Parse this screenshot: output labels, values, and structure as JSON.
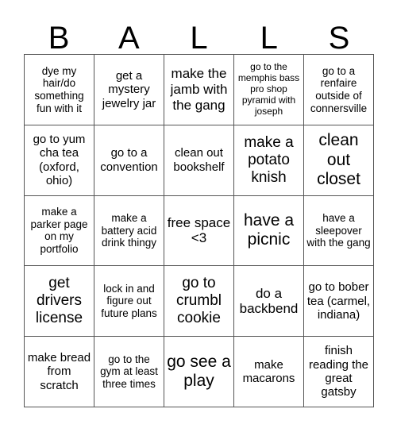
{
  "card": {
    "header_letters": [
      "B",
      "A",
      "L",
      "L",
      "S"
    ],
    "colors": {
      "background": "#ffffff",
      "text": "#000000",
      "grid_line": "#555555"
    },
    "grid_size": "5x5",
    "rows": [
      [
        {
          "text": "dye my hair/do something fun with it",
          "size": "s"
        },
        {
          "text": "get a mystery jewelry jar",
          "size": "m"
        },
        {
          "text": "make the jamb with the gang",
          "size": "l"
        },
        {
          "text": "go to the memphis bass pro shop pyramid with joseph",
          "size": "xs"
        },
        {
          "text": "go to a renfaire outside of connersville",
          "size": "s"
        }
      ],
      [
        {
          "text": "go to yum cha tea (oxford, ohio)",
          "size": "m"
        },
        {
          "text": "go to a convention",
          "size": "m"
        },
        {
          "text": "clean out bookshelf",
          "size": "m"
        },
        {
          "text": "make a potato knish",
          "size": "xl"
        },
        {
          "text": "clean out closet",
          "size": "xxl"
        }
      ],
      [
        {
          "text": "make a parker page on my portfolio",
          "size": "s"
        },
        {
          "text": "make a battery acid drink thingy",
          "size": "s"
        },
        {
          "text": "free space <3",
          "size": "l"
        },
        {
          "text": "have a picnic",
          "size": "xxl"
        },
        {
          "text": "have a sleepover with the gang",
          "size": "s"
        }
      ],
      [
        {
          "text": "get drivers license",
          "size": "xl"
        },
        {
          "text": "lock in and figure out future plans",
          "size": "s"
        },
        {
          "text": "go to crumbl cookie",
          "size": "xl"
        },
        {
          "text": "do a backbend",
          "size": "l"
        },
        {
          "text": "go to bober tea (carmel, indiana)",
          "size": "m"
        }
      ],
      [
        {
          "text": "make bread from scratch",
          "size": "m"
        },
        {
          "text": "go to the gym at least three times",
          "size": "s"
        },
        {
          "text": "go see a play",
          "size": "xxl"
        },
        {
          "text": "make macarons",
          "size": "m"
        },
        {
          "text": "finish reading the great gatsby",
          "size": "m"
        }
      ]
    ]
  }
}
